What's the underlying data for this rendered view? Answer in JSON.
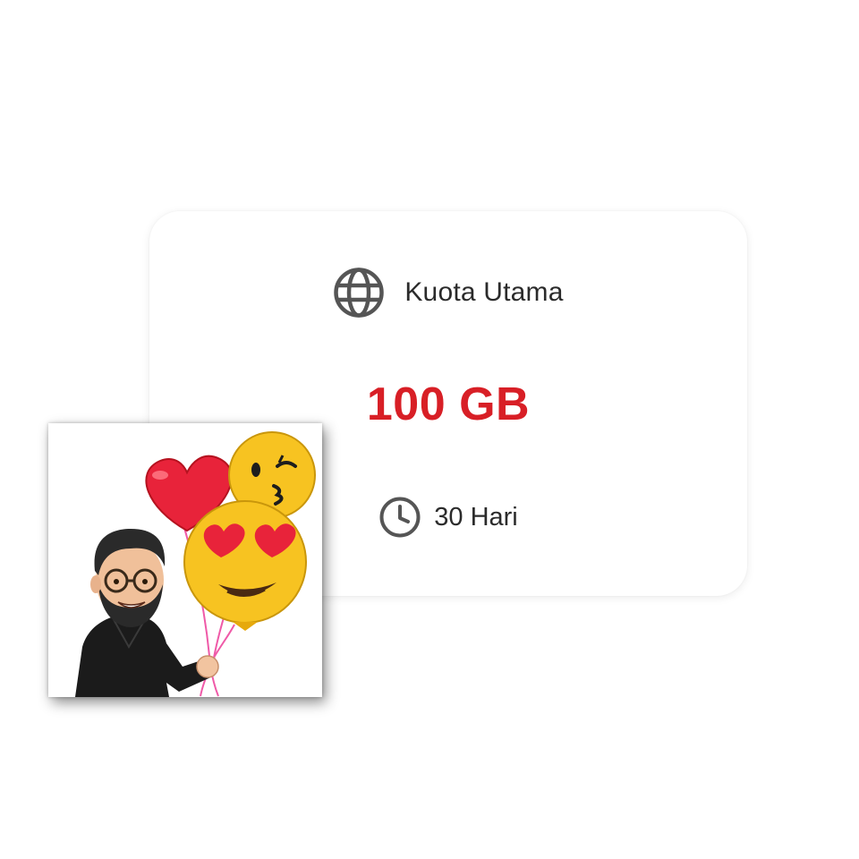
{
  "card": {
    "quota_label": "Kuota Utama",
    "quota_icon": "globe-icon",
    "amount": "100 GB",
    "duration_label": "30 Hari",
    "duration_icon": "clock-icon"
  },
  "sticker": {
    "description_icon": "bitmoji-with-balloons"
  },
  "colors": {
    "accent": "#d81f26",
    "text": "#2b2b2b",
    "icon": "#555555"
  }
}
